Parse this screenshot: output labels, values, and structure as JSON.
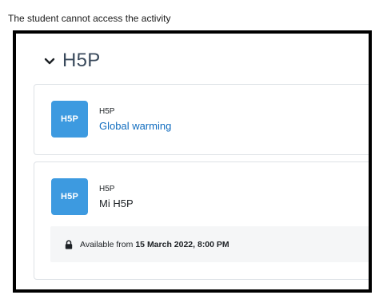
{
  "caption": "The student cannot access the activity",
  "section": {
    "title": "H5P",
    "toggle_icon": "chevron-down-icon"
  },
  "activities": [
    {
      "icon_text": "H5P",
      "type_label": "H5P",
      "name": "Global warming",
      "accessible": true
    },
    {
      "icon_text": "H5P",
      "type_label": "H5P",
      "name": "Mi H5P",
      "accessible": false,
      "restriction": {
        "icon": "lock-icon",
        "prefix": "Available from",
        "date": "15 March 2022, 8:00 PM"
      }
    }
  ],
  "colors": {
    "icon_bg": "#3d9ae0",
    "link": "#0f6cbf",
    "restriction_bg": "#f5f6f7"
  }
}
